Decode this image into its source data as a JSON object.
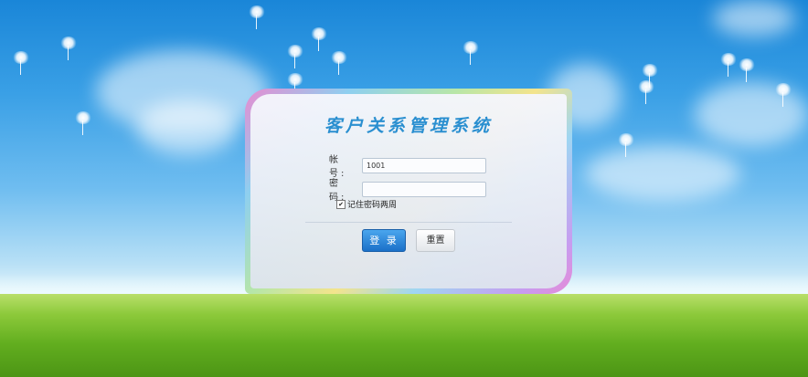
{
  "login": {
    "title": "客户关系管理系统",
    "account_label": "帐　号:",
    "account_value": "1001",
    "password_label": "密　码:",
    "password_value": "",
    "remember_label": "记住密码两周",
    "remember_checked": true,
    "login_button": "登 录",
    "reset_button": "重置"
  },
  "colors": {
    "title": "#2a8fd0",
    "login_button": "#1b70c8"
  }
}
